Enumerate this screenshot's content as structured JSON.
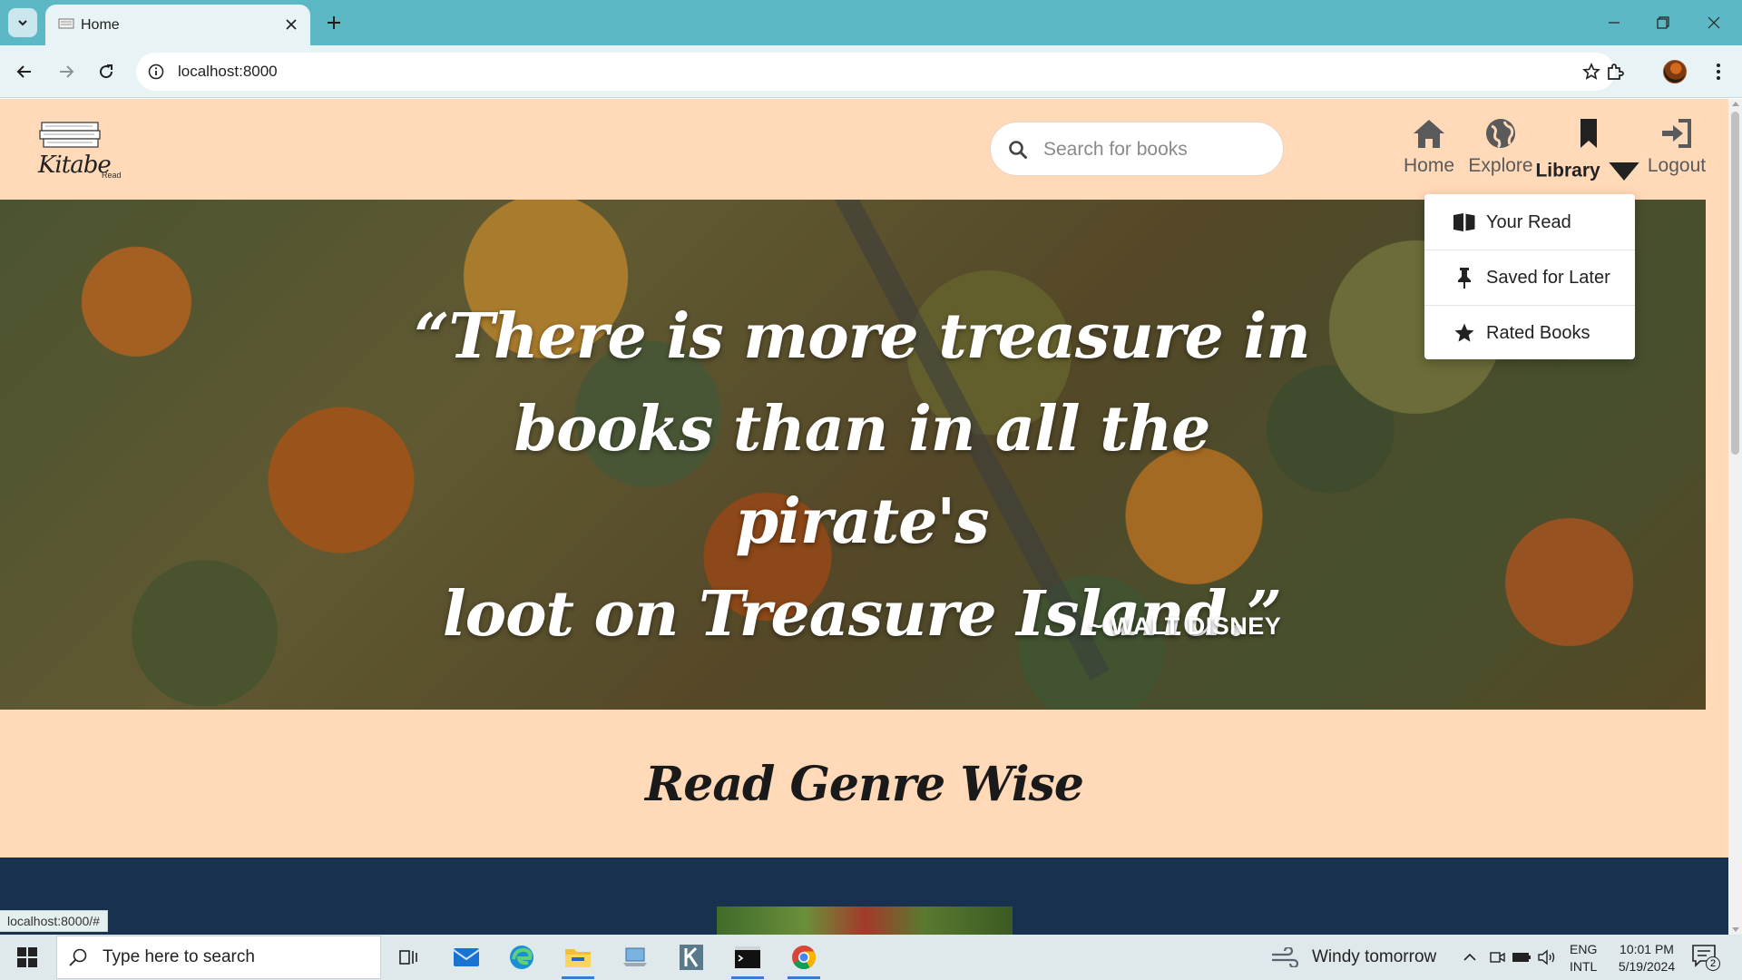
{
  "browser": {
    "tab_title": "Home",
    "url": "localhost:8000",
    "status_url": "localhost:8000/#"
  },
  "site": {
    "logo_text": "Kitabe",
    "logo_sub": "Read",
    "search_placeholder": "Search for books",
    "nav": [
      {
        "label": "Home",
        "icon": "home-icon"
      },
      {
        "label": "Explore",
        "icon": "globe-icon"
      },
      {
        "label": "Library",
        "icon": "bookmark-icon"
      },
      {
        "label": "Logout",
        "icon": "sign-in-icon"
      }
    ],
    "library_menu": [
      {
        "label": "Your Read",
        "icon": "book-reader-icon"
      },
      {
        "label": "Saved for Later",
        "icon": "thumbtack-icon"
      },
      {
        "label": "Rated Books",
        "icon": "star-icon"
      }
    ]
  },
  "hero": {
    "quote_line1": "“There is more treasure in",
    "quote_line2": "books than in all the pirate's",
    "quote_line3": "loot on Treasure Island.”",
    "attribution": "~ WALT DISNEY"
  },
  "genre": {
    "title": "Read Genre Wise"
  },
  "taskbar": {
    "search_text": "Type here to search",
    "weather": "Windy tomorrow",
    "lang_line1": "ENG",
    "lang_line2": "INTL",
    "time": "10:01 PM",
    "date": "5/19/2024",
    "notification_count": "2"
  },
  "colors": {
    "page_bg": "#ffd9b8",
    "dark_section": "#17314f",
    "chrome_tabbar": "#5cb8c5",
    "chrome_toolbar": "#e7f3f4"
  }
}
